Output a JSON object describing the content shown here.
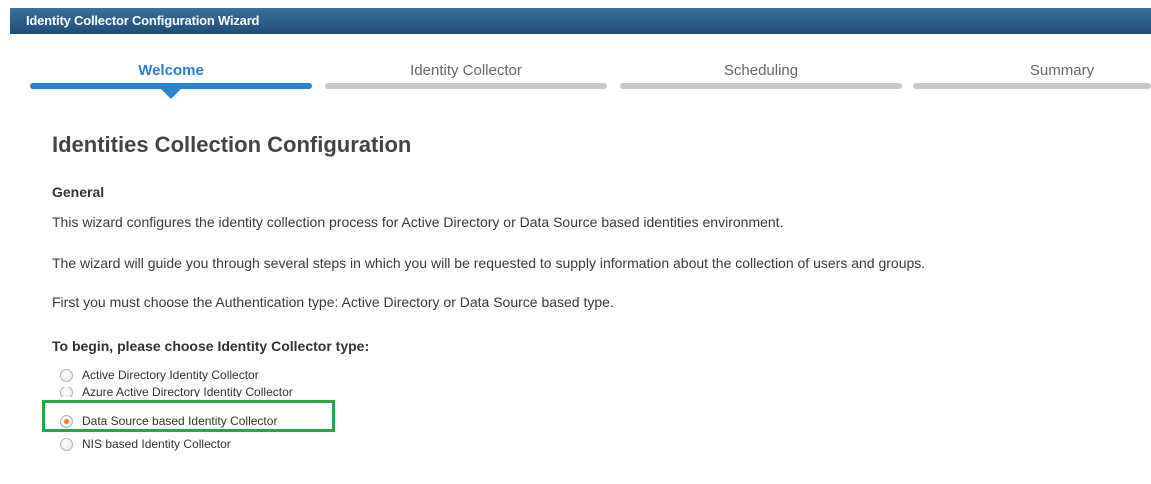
{
  "window": {
    "title": "Identity Collector Configuration Wizard"
  },
  "wizard_steps": [
    {
      "label": "Welcome",
      "active": true
    },
    {
      "label": "Identity Collector",
      "active": false
    },
    {
      "label": "Scheduling",
      "active": false
    },
    {
      "label": "Summary",
      "active": false
    }
  ],
  "page": {
    "title": "Identities Collection Configuration",
    "section_heading": "General",
    "paragraphs": [
      "This wizard configures the identity collection process for Active Directory or Data Source based identities environment.",
      "The wizard will guide you through several steps in which you will be requested to supply information about the collection of users and groups.",
      " First you must choose the Authentication type: Active Directory or Data Source based type."
    ],
    "choose_label": "To begin, please choose Identity Collector type:",
    "options": [
      {
        "label": "Active Directory Identity Collector",
        "checked": false
      },
      {
        "label": "Azure Active Directory Identity Collector",
        "checked": false
      },
      {
        "label": "Data Source based Identity Collector",
        "checked": true
      },
      {
        "label": "NIS based Identity Collector",
        "checked": false
      }
    ],
    "highlight_color": "#27a844"
  },
  "colors": {
    "accent": "#2b82d3",
    "titlebar": "#2a5a85",
    "radio_selected": "#f07a2a"
  }
}
